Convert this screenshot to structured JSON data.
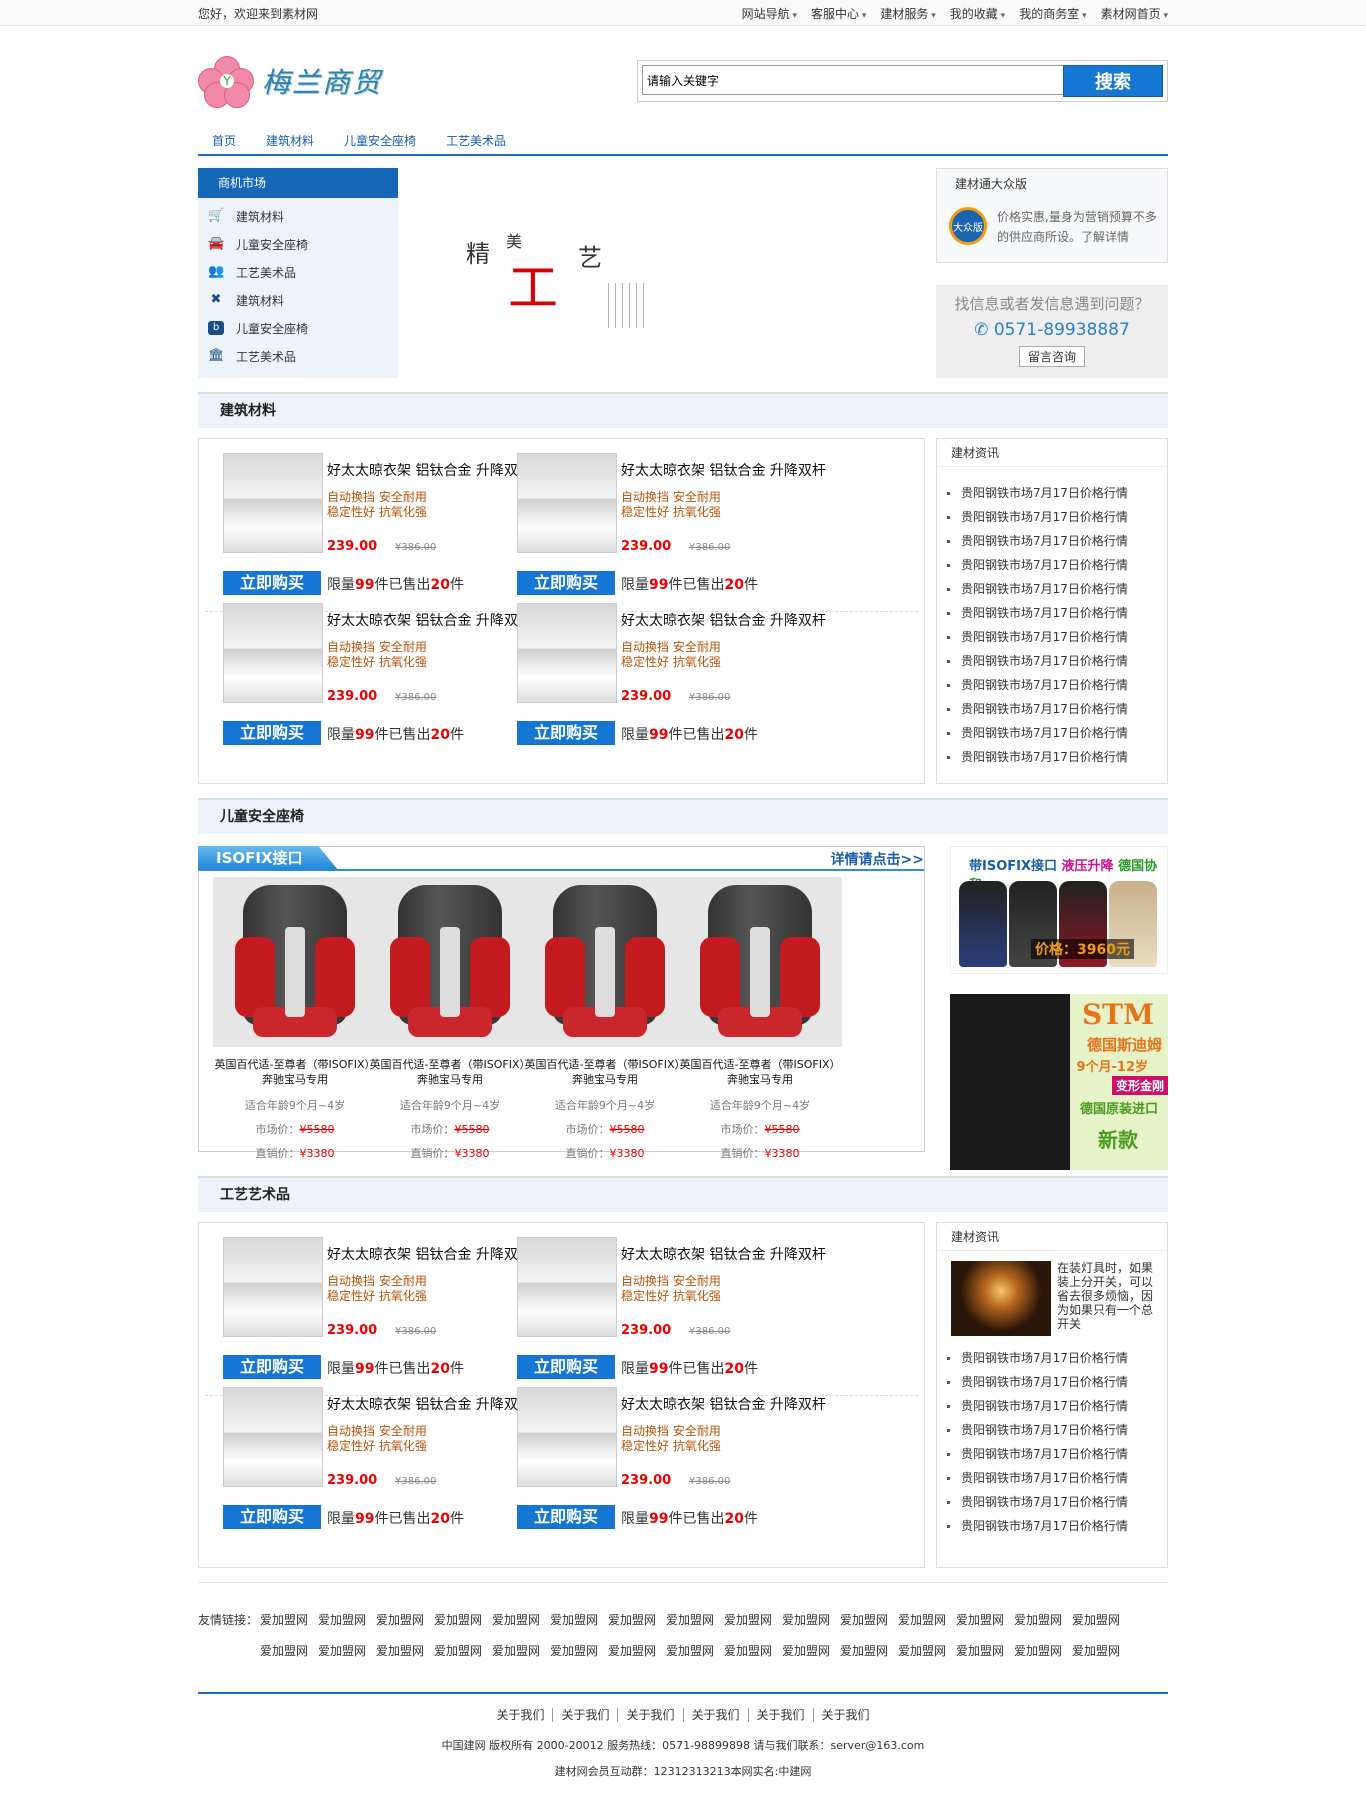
{
  "topbar": {
    "welcome": "您好，欢迎来到素材网",
    "links": [
      "网站导航",
      "客服中心",
      "建材服务",
      "我的收藏",
      "我的商务室",
      "素材网首页"
    ]
  },
  "logo": {
    "text": "梅兰商贸"
  },
  "search": {
    "placeholder": "请输入关键字",
    "button": "搜索"
  },
  "nav": [
    "首页",
    "建筑材料",
    "儿童安全座椅",
    "工艺美术品"
  ],
  "catbox": {
    "title": "商机市场",
    "items": [
      {
        "label": "建筑材料",
        "icon": "cart-icon"
      },
      {
        "label": "儿童安全座椅",
        "icon": "car-icon"
      },
      {
        "label": "工艺美术品",
        "icon": "users-icon"
      },
      {
        "label": "建筑材料",
        "icon": "tools-icon"
      },
      {
        "label": "儿童安全座椅",
        "icon": "b-icon"
      },
      {
        "label": "工艺美术品",
        "icon": "bank-icon"
      }
    ]
  },
  "banner": {
    "c1": "精",
    "c2": "美",
    "c3": "工",
    "c4": "艺"
  },
  "ad1": {
    "title": "建材通大众版",
    "badge": "大众版",
    "text": "价格实惠,量身为营销预算不多的供应商所设。了解详情"
  },
  "ad2": {
    "question": "找信息或者发信息遇到问题？",
    "phone": "0571-89938887",
    "button": "留言咨询"
  },
  "sections": {
    "s1": "建筑材料",
    "s2": "儿童安全座椅",
    "s3": "工艺艺术品"
  },
  "product": {
    "title": "好太太晾衣架 铝钛合金 升降双杆",
    "feat1": "自动换挡 安全耐用",
    "feat2": "稳定性好 抗氧化强",
    "price": "239.00",
    "old": "¥386.00",
    "buy": "立即购买",
    "limit_a": "限量",
    "limit_n": "99",
    "limit_b": "件已售出",
    "limit_s": "20",
    "limit_c": "件"
  },
  "news": {
    "title": "建材资讯",
    "item": "贵阳钢铁市场7月17日价格行情"
  },
  "seats": {
    "tab": "ISOFIX接口",
    "detail": "详情请点击>>",
    "name": "英国百代适-至尊者（带ISOFIX）奔驰宝马专用",
    "age": "适合年龄9个月~4岁",
    "market_label": "市场价：",
    "market": "¥5580",
    "direct_label": "直销价：",
    "direct": "¥3380"
  },
  "adseat1": {
    "a": "带ISOFIX接口",
    "b": "液压升降",
    "c": "德国协和",
    "price": "价格：3960元"
  },
  "adseat2": {
    "stm": "STM",
    "l1": "德国斯迪姆",
    "l2": "9个月-12岁",
    "l3": "变形金刚",
    "l4": "德国原装进口",
    "l5": "新款"
  },
  "art_news": {
    "title": "建材资讯",
    "text": "在装灯具时，如果装上分开关，可以省去很多烦恼，因为如果只有一个总开关"
  },
  "friend": {
    "label": "友情链接：",
    "link": "爱加盟网"
  },
  "footer": {
    "nav": [
      "关于我们",
      "关于我们",
      "关于我们",
      "关于我们",
      "关于我们",
      "关于我们"
    ],
    "line1": "中国建网 版权所有 2000-20012 服务热线：0571-98899898 请与我们联系：server@163.com",
    "line2": "建材网会员互动群：12312313213本网实名:中建网"
  },
  "colors": {
    "brand": "#1577d3",
    "price": "#ee0000",
    "feature": "#b5540b"
  }
}
